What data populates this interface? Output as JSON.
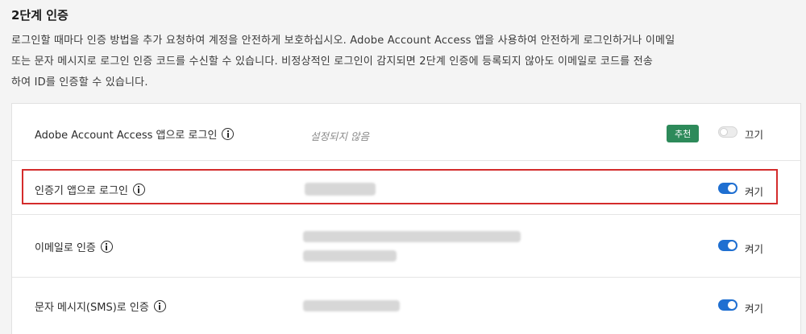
{
  "section": {
    "title": "2단계 인증",
    "description_lines": [
      "로그인할 때마다 인증 방법을 추가 요청하여 계정을 안전하게 보호하십시오. Adobe Account Access 앱을 사용하여 안전하게 로그인하거나 이메일",
      "또는 문자 메시지로 로그인 인증 코드를 수신할 수 있습니다. 비정상적인 로그인이 감지되면 2단계 인증에 등록되지 않아도 이메일로 코드를 전송",
      "하여 ID를 인증할 수 있습니다."
    ]
  },
  "rows": [
    {
      "label": "Adobe Account Access 앱으로 로그인",
      "value": "설정되지 않음",
      "badge": "추천",
      "toggle_state": "off",
      "toggle_label": "끄기",
      "icon": "info-icon"
    },
    {
      "label": "인증기 앱으로 로그인",
      "value": "",
      "toggle_state": "on",
      "toggle_label": "켜기",
      "icon": "info-icon",
      "highlighted": true
    },
    {
      "label": "이메일로 인증",
      "value": "",
      "toggle_state": "on",
      "toggle_label": "켜기",
      "icon": "info-icon"
    },
    {
      "label": "문자 메시지(SMS)로 인증",
      "value": "",
      "toggle_state": "on",
      "toggle_label": "켜기",
      "icon": "info-icon"
    }
  ],
  "colors": {
    "toggle_on": "#1f6fd1",
    "badge": "#2d8a5a",
    "highlight": "#d42c2c"
  }
}
